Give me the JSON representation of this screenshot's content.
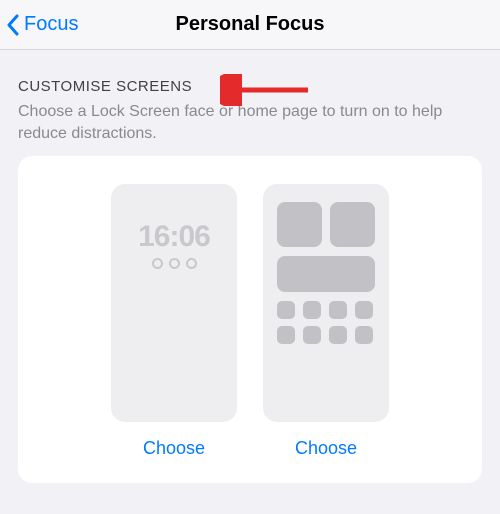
{
  "nav": {
    "back_label": "Focus",
    "title": "Personal Focus"
  },
  "section": {
    "header": "CUSTOMISE SCREENS",
    "description": "Choose a Lock Screen face or home page to turn on to help reduce distractions."
  },
  "options": {
    "lock_screen": {
      "time": "16:06",
      "button": "Choose"
    },
    "home_screen": {
      "button": "Choose"
    }
  },
  "annotation": {
    "arrow_color": "#e42a2a"
  }
}
